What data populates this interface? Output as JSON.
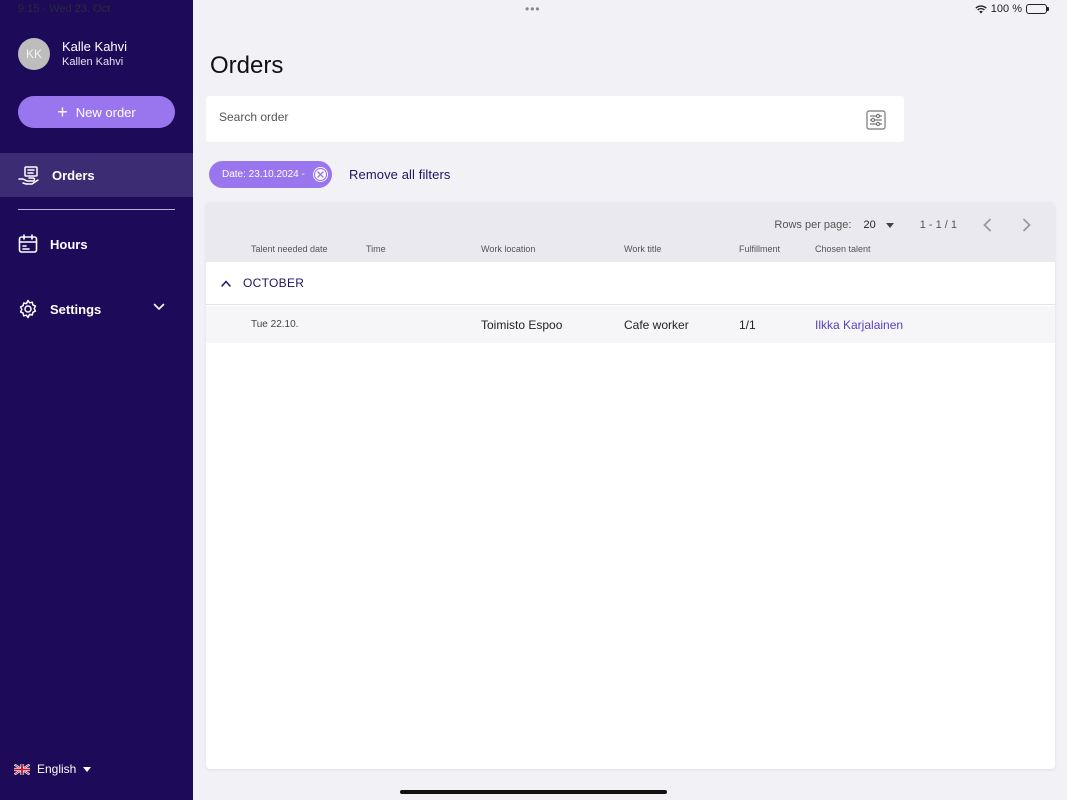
{
  "status": {
    "time": "9:15 · Wed 23. Oct",
    "battery": "100 %"
  },
  "sidebar": {
    "user": {
      "initials": "KK",
      "name": "Kalle Kahvi",
      "company": "Kallen Kahvi"
    },
    "new_order_label": "New order",
    "nav": [
      {
        "label": "Orders",
        "icon": "orders-icon",
        "active": true
      },
      {
        "label": "Hours",
        "icon": "calendar-icon",
        "active": false
      },
      {
        "label": "Settings",
        "icon": "gear-icon",
        "active": false
      }
    ],
    "language": "English"
  },
  "main": {
    "title": "Orders",
    "search": {
      "placeholder": "Search order",
      "value": ""
    },
    "filters": {
      "chips": [
        "Date: 23.10.2024 -"
      ],
      "remove_all_label": "Remove all filters"
    },
    "table": {
      "rows_per_page_label": "Rows per page:",
      "rows_per_page_value": "20",
      "range": "1 - 1 / 1",
      "columns": [
        "Talent needed date",
        "Time",
        "Work location",
        "Work title",
        "Fulfillment",
        "Chosen talent"
      ],
      "groups": [
        {
          "label": "OCTOBER",
          "expanded": true,
          "rows": [
            {
              "date": "Tue 22.10.",
              "time": "",
              "location": "Toimisto Espoo",
              "title": "Cafe worker",
              "fulfillment": "1/1",
              "talent": "Ilkka Karjalainen"
            }
          ]
        }
      ]
    }
  },
  "colors": {
    "sidebar": "#1d0b5a",
    "accent": "#9a76ee",
    "active_nav": "#3c2c74",
    "link": "#5a3fbf"
  }
}
